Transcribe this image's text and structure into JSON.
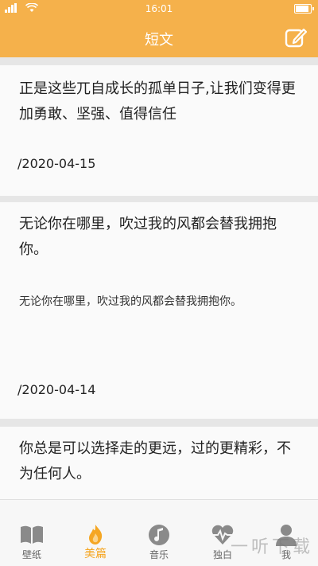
{
  "status_bar": {
    "carrier": "",
    "time": "16:01"
  },
  "nav": {
    "title": "短文"
  },
  "cards": [
    {
      "title": "正是这些兀自成长的孤单日子,让我们变得更加勇敢、坚强、值得信任",
      "body": "",
      "date": "/2020-04-15"
    },
    {
      "title": "无论你在哪里，吹过我的风都会替我拥抱你。",
      "body": "无论你在哪里，吹过我的风都会替我拥抱你。",
      "date": "/2020-04-14"
    },
    {
      "title": "你总是可以选择走的更远，过的更精彩，不为任何人。",
      "body": "",
      "date": ""
    }
  ],
  "tabs": [
    {
      "label": "壁纸",
      "icon": "book-icon"
    },
    {
      "label": "美篇",
      "icon": "flame-icon",
      "active": true
    },
    {
      "label": "音乐",
      "icon": "music-note-icon"
    },
    {
      "label": "独白",
      "icon": "heartbeat-icon"
    },
    {
      "label": "我",
      "icon": "person-icon"
    }
  ],
  "watermark": "一听下载",
  "colors": {
    "accent": "#f5b14b",
    "active_tab": "#f5a623"
  }
}
